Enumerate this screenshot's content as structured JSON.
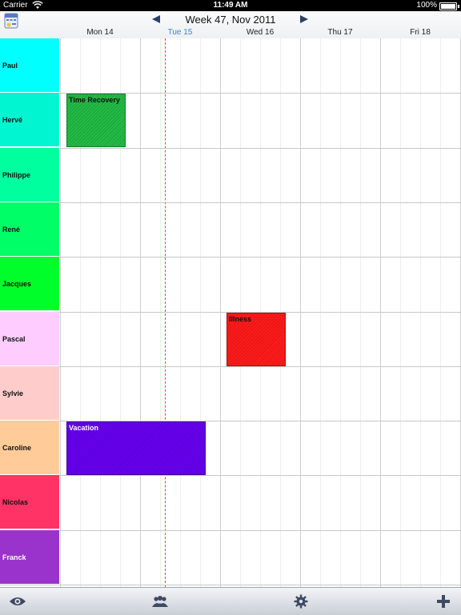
{
  "status_bar": {
    "carrier": "Carrier",
    "time": "11:49 AM",
    "battery": "100%"
  },
  "header": {
    "week_title": "Week 47, Nov 2011",
    "days": [
      {
        "label": "Mon 14",
        "today": false
      },
      {
        "label": "Tue 15",
        "today": true
      },
      {
        "label": "Wed 16",
        "today": false
      },
      {
        "label": "Thu 17",
        "today": false
      },
      {
        "label": "Fri 18",
        "today": false
      }
    ]
  },
  "people": [
    {
      "name": "Paul",
      "color": "#00ffff",
      "light_text": false
    },
    {
      "name": "Hervé",
      "color": "#00f5d0",
      "light_text": false
    },
    {
      "name": "Philippe",
      "color": "#00ff9f",
      "light_text": false
    },
    {
      "name": "René",
      "color": "#00ff66",
      "light_text": false
    },
    {
      "name": "Jacques",
      "color": "#00ff2a",
      "light_text": false
    },
    {
      "name": "Pascal",
      "color": "#ffccff",
      "light_text": false
    },
    {
      "name": "Sylvie",
      "color": "#ffcccc",
      "light_text": false
    },
    {
      "name": "Caroline",
      "color": "#ffcc99",
      "light_text": false
    },
    {
      "name": "Nicolas",
      "color": "#ff3366",
      "light_text": false
    },
    {
      "name": "Franck",
      "color": "#9933cc",
      "light_text": true
    }
  ],
  "events": [
    {
      "label": "Time Recovery",
      "person": 1,
      "start": 0.08,
      "end": 0.82,
      "color": "#22bb44",
      "light_text": false
    },
    {
      "label": "Illness",
      "person": 5,
      "start": 2.08,
      "end": 2.82,
      "color": "#ff1a1a",
      "light_text": false
    },
    {
      "label": "Vacation",
      "person": 7,
      "start": 0.08,
      "end": 1.82,
      "color": "#6600ee",
      "light_text": true
    }
  ],
  "tabbar": {
    "items": [
      {
        "icon": "eye-icon"
      },
      {
        "icon": "people-icon"
      },
      {
        "icon": "gear-icon"
      },
      {
        "icon": "plus-icon"
      }
    ]
  }
}
